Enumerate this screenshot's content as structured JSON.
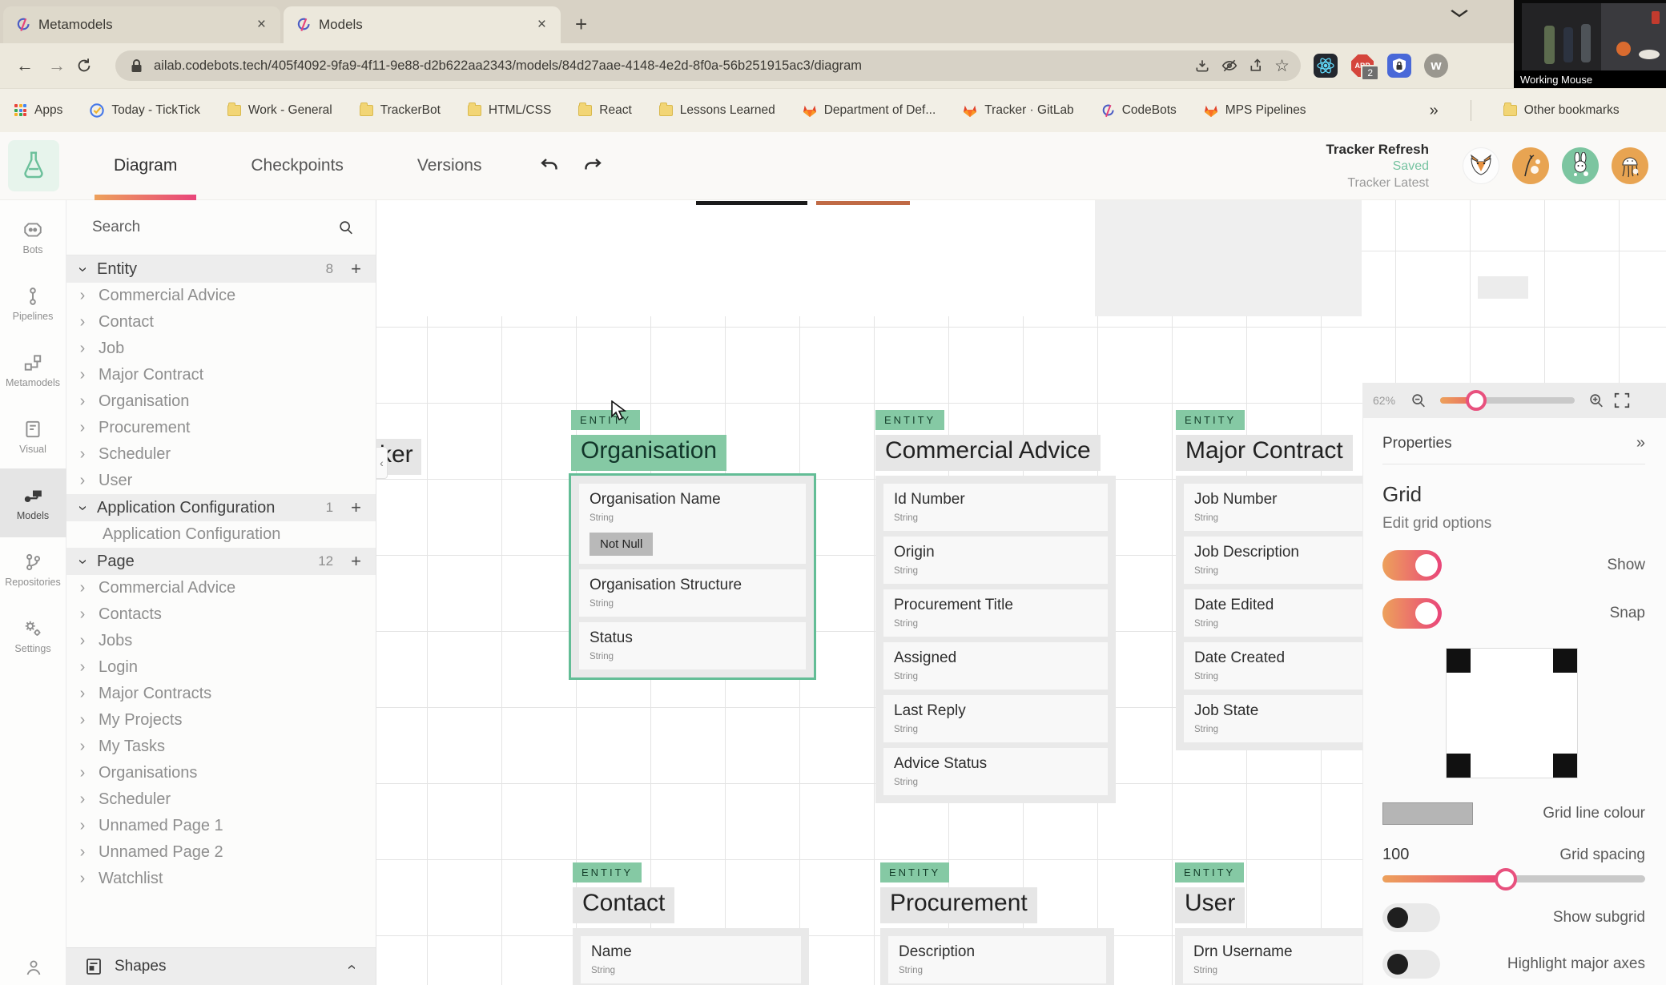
{
  "icons": {
    "close": "×",
    "plus": "+",
    "back": "←",
    "forward": "→",
    "star": "☆",
    "chevron": "›",
    "overflow": "»",
    "collapse": "‹",
    "panel_collapse": "»",
    "tabstrip_chevron": "v",
    "w_mark": "w",
    "abp_text": "ABP"
  },
  "browser": {
    "tabs": [
      {
        "title": "Metamodels"
      },
      {
        "title": "Models"
      }
    ],
    "url": "ailab.codebots.tech/405f4092-9fa9-4f11-9e88-d2b622aa2343/models/84d27aae-4148-4e2d-8f0a-56b251915ac3/diagram",
    "abp_badge": "2",
    "bookmarks": [
      "Apps",
      "Today - TickTick",
      "Work - General",
      "TrackerBot",
      "HTML/CSS",
      "React",
      "Lessons Learned",
      "Department of Def...",
      "Tracker · GitLab",
      "CodeBots",
      "MPS Pipelines"
    ],
    "other_bookmarks": "Other bookmarks",
    "pip_caption": "Working Mouse"
  },
  "header": {
    "tabs": [
      "Diagram",
      "Checkpoints",
      "Versions"
    ],
    "status_title": "Tracker Refresh",
    "status_saved": "Saved",
    "status_sub": "Tracker Latest"
  },
  "rail": {
    "items": [
      "Bots",
      "Pipelines",
      "Metamodels",
      "Visual",
      "Models",
      "Repositories",
      "Settings"
    ]
  },
  "explorer": {
    "search_label": "Search",
    "sections": [
      {
        "label": "Entity",
        "count": "8",
        "children": [
          "Commercial Advice",
          "Contact",
          "Job",
          "Major Contract",
          "Organisation",
          "Procurement",
          "Scheduler",
          "User"
        ]
      },
      {
        "label": "Application Configuration",
        "count": "1",
        "children": [
          "Application Configuration"
        ]
      },
      {
        "label": "Page",
        "count": "12",
        "children": [
          "Commercial Advice",
          "Contacts",
          "Jobs",
          "Login",
          "Major Contracts",
          "My Projects",
          "My Tasks",
          "Organisations",
          "Scheduler",
          "Unnamed Page 1",
          "Unnamed Page 2",
          "Watchlist"
        ]
      }
    ],
    "shapes_label": "Shapes"
  },
  "canvas": {
    "badge": "ENTITY",
    "partial_title": "ker",
    "entities": [
      {
        "name": "Organisation",
        "attrs": [
          {
            "name": "Organisation Name",
            "type": "String",
            "flag": "Not Null"
          },
          {
            "name": "Organisation Structure",
            "type": "String"
          },
          {
            "name": "Status",
            "type": "String"
          }
        ]
      },
      {
        "name": "Commercial Advice",
        "attrs": [
          {
            "name": "Id Number",
            "type": "String"
          },
          {
            "name": "Origin",
            "type": "String"
          },
          {
            "name": "Procurement Title",
            "type": "String"
          },
          {
            "name": "Assigned",
            "type": "String"
          },
          {
            "name": "Last Reply",
            "type": "String"
          },
          {
            "name": "Advice Status",
            "type": "String"
          }
        ]
      },
      {
        "name": "Major Contract",
        "attrs": [
          {
            "name": "Job Number",
            "type": "String"
          },
          {
            "name": "Job Description",
            "type": "String"
          },
          {
            "name": "Date Edited",
            "type": "String"
          },
          {
            "name": "Date Created",
            "type": "String"
          },
          {
            "name": "Job State",
            "type": "String"
          }
        ]
      },
      {
        "name": "Contact",
        "attrs": [
          {
            "name": "Name",
            "type": "String"
          }
        ]
      },
      {
        "name": "Procurement",
        "attrs": [
          {
            "name": "Description",
            "type": "String"
          }
        ]
      },
      {
        "name": "User",
        "attrs": [
          {
            "name": "Drn Username",
            "type": "String"
          }
        ]
      }
    ]
  },
  "properties": {
    "zoom_level": "62%",
    "panel_title": "Properties",
    "section_title": "Grid",
    "section_subtitle": "Edit grid options",
    "toggle_show": "Show",
    "toggle_snap": "Snap",
    "grid_line_colour_label": "Grid line colour",
    "grid_spacing_value": "100",
    "grid_spacing_label": "Grid spacing",
    "toggle_subgrid": "Show subgrid",
    "toggle_axes": "Highlight major axes",
    "accent_start": "#eda15b",
    "accent_end": "#e9457a",
    "entity_green": "#85c9a4"
  }
}
